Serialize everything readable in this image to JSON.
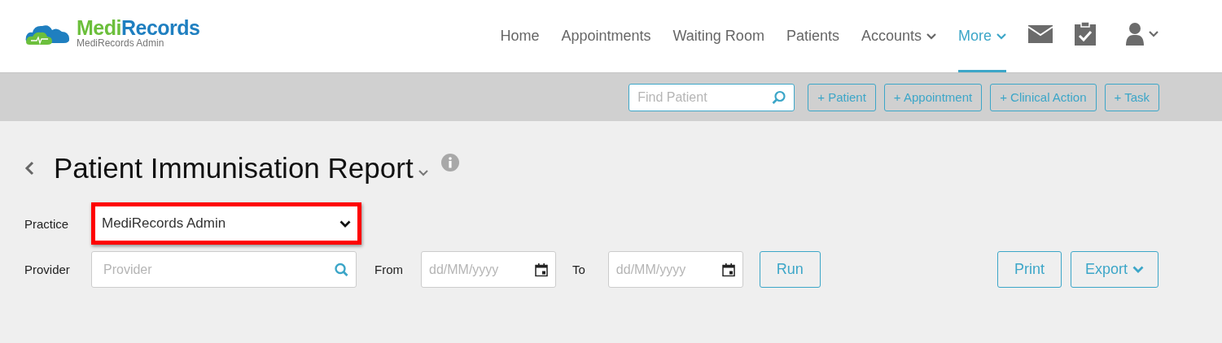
{
  "logo": {
    "brand_first": "Medi",
    "brand_second": "Records",
    "subtitle": "MediRecords Admin"
  },
  "nav": [
    {
      "label": "Home",
      "selected": false,
      "has_caret": false
    },
    {
      "label": "Appointments",
      "selected": false,
      "has_caret": false
    },
    {
      "label": "Waiting Room",
      "selected": false,
      "has_caret": false
    },
    {
      "label": "Patients",
      "selected": false,
      "has_caret": false
    },
    {
      "label": "Accounts",
      "selected": false,
      "has_caret": true
    },
    {
      "label": "More",
      "selected": true,
      "has_caret": true
    }
  ],
  "toolbar": {
    "search": {
      "placeholder": "Find Patient"
    },
    "buttons": [
      "+ Patient",
      "+ Appointment",
      "+ Clinical Action",
      "+ Task"
    ]
  },
  "report": {
    "title": "Patient Immunisation Report"
  },
  "filters": {
    "practice": {
      "label": "Practice",
      "value": "MediRecords Admin",
      "highlighted": true
    },
    "provider": {
      "label": "Provider",
      "placeholder": "Provider"
    },
    "from": {
      "label": "From",
      "placeholder": "dd/MM/yyyy"
    },
    "to": {
      "label": "To",
      "placeholder": "dd/MM/yyyy"
    },
    "run": "Run",
    "print": "Print",
    "export": "Export"
  }
}
